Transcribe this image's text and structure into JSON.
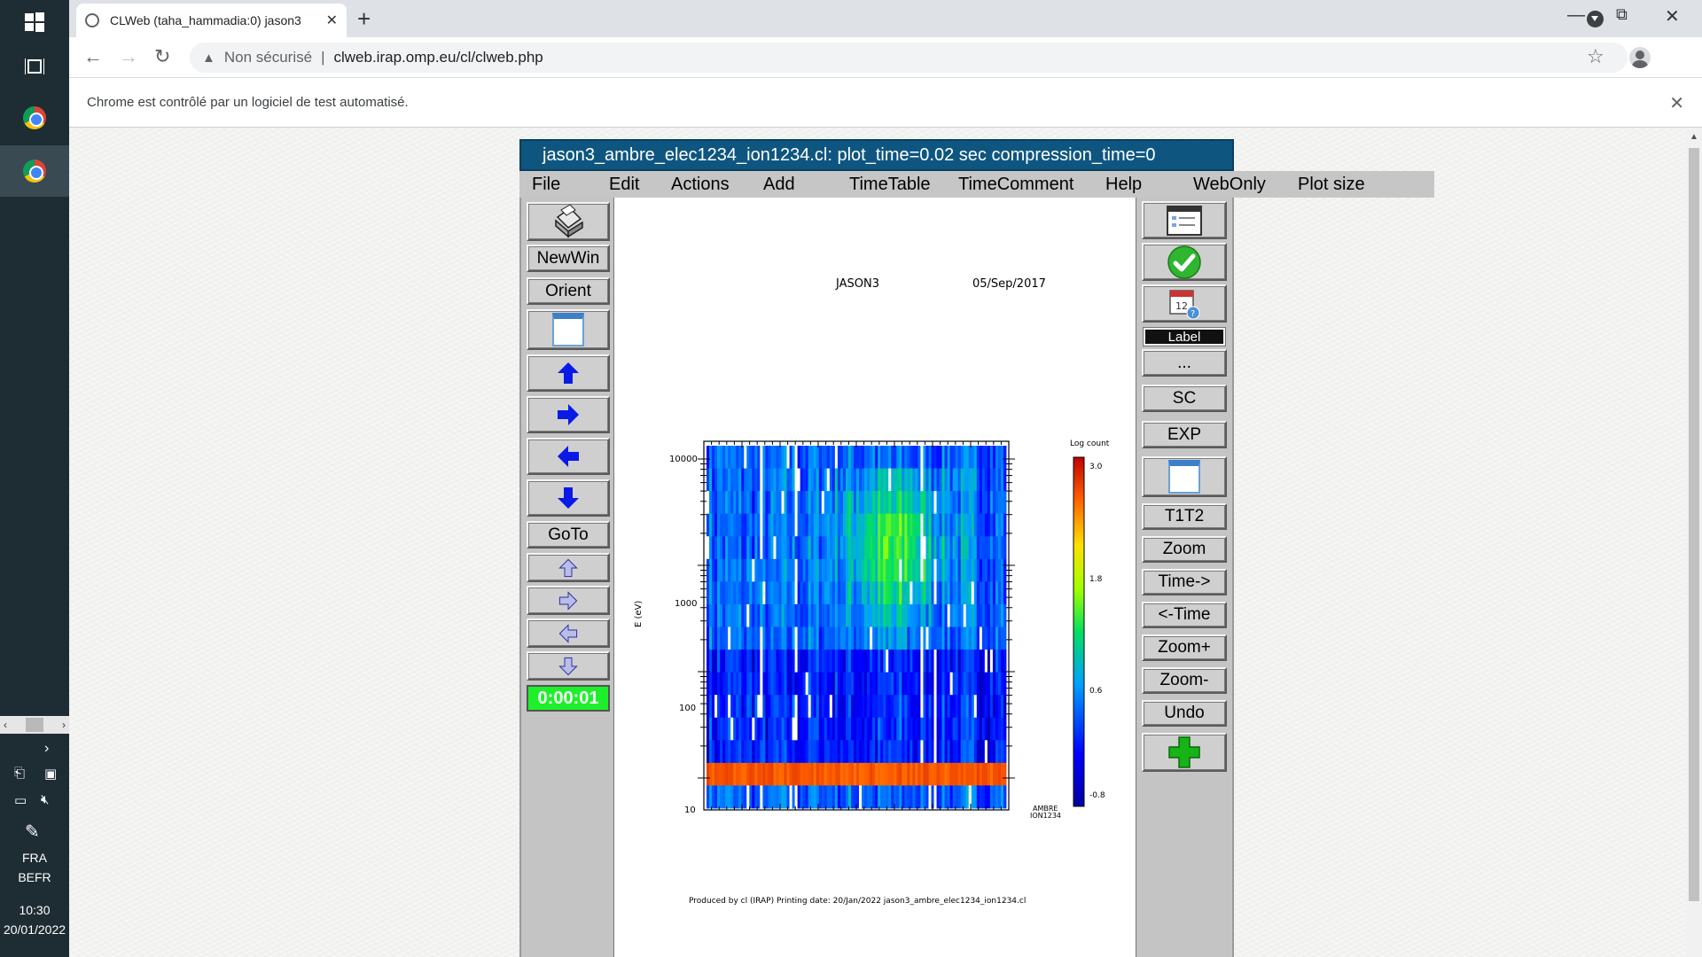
{
  "taskbar": {
    "language": "FRA",
    "layout": "BEFR",
    "time": "10:30",
    "date": "20/01/2022"
  },
  "browser": {
    "tab_title": "CLWeb (taha_hammadia:0) jason3",
    "security_label": "Non sécurisé",
    "url": "clweb.irap.omp.eu/cl/clweb.php",
    "info_message": "Chrome est contrôlé par un logiciel de test automatisé."
  },
  "app": {
    "title": "jason3_ambre_elec1234_ion1234.cl:     plot_time=0.02 sec  compression_time=0",
    "menu": [
      "File",
      "Edit",
      "Actions",
      "Add",
      "TimeTable",
      "TimeComment",
      "Help",
      "WebOnly",
      "Plot size"
    ],
    "left_buttons": {
      "newwin": "NewWin",
      "orient": "Orient",
      "goto": "GoTo",
      "timer": "0:00:01"
    },
    "right_buttons": {
      "label": "Label",
      "more": "...",
      "sc": "SC",
      "exp": "EXP",
      "t1t2": "T1T2",
      "zoom": "Zoom",
      "time_fwd": "Time->",
      "time_back": "<-Time",
      "zoom_plus": "Zoom+",
      "zoom_minus": "Zoom-",
      "undo": "Undo"
    }
  },
  "plot": {
    "header_left": "JASON3",
    "header_right": "05/Sep/2017",
    "ylabel": "E (eV)",
    "yticks": [
      "10000",
      "1000",
      "100",
      "10"
    ],
    "colorbar_title": "Log count",
    "colorbar_ticks": [
      "3.0",
      "1.8",
      "0.6",
      "-0.8"
    ],
    "instrument": [
      "AMBRE",
      "ION1234"
    ],
    "footer": "Produced by cl (IRAP)    Printing date: 20/Jan/2022    jason3_ambre_elec1234_ion1234.cl"
  },
  "chart_data": {
    "type": "heatmap",
    "title": "JASON3  05/Sep/2017",
    "ylabel": "E (eV)",
    "yscale": "log",
    "ytick_labels": [
      "10000",
      "1000",
      "100",
      "10"
    ],
    "colorbar_label": "Log count",
    "colorbar_range": [
      -0.8,
      3.0
    ],
    "colorbar_ticks": [
      3.0,
      1.8,
      0.6,
      -0.8
    ],
    "description_bands": "Dense blue spectrogram with green patch near 1000-10000 eV in the middle-right, and a strong red band around 10-20 eV"
  }
}
